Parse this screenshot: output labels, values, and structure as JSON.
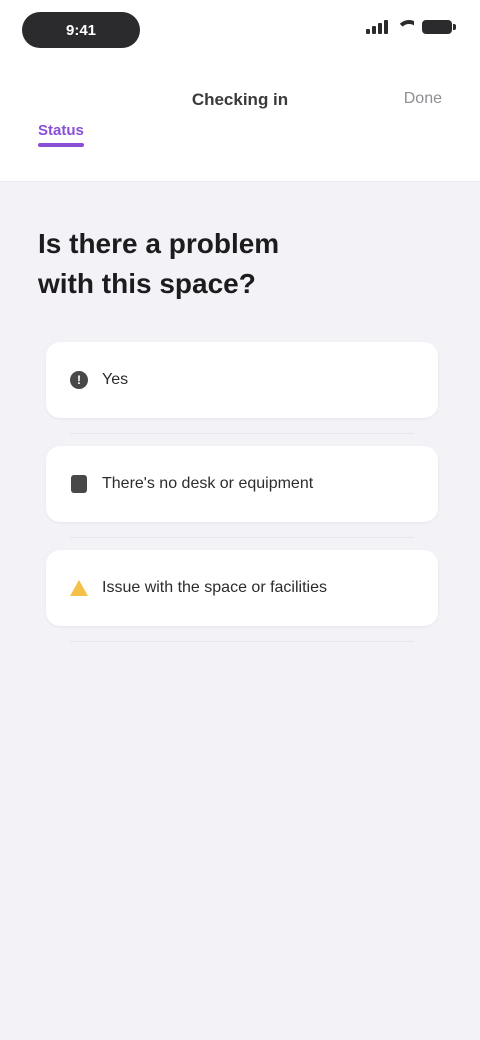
{
  "status_bar": {
    "time": "9:41",
    "signal_icon": "signal-icon",
    "wifi_icon": "wifi-icon",
    "battery_icon": "battery-icon"
  },
  "nav": {
    "title": "Checking in",
    "action_label": "Done",
    "selected_tab": "Status"
  },
  "heading": "Is there a problem with this space?",
  "options": [
    {
      "label": "Yes",
      "icon": "alert-icon"
    },
    {
      "label": "There's no desk or equipment",
      "icon": "grid-icon"
    },
    {
      "label": "Issue with the space or facilities",
      "icon": "warning-icon"
    }
  ],
  "colors": {
    "accent": "#8a4fd6",
    "background": "#f2f2f7",
    "card": "#ffffff",
    "warning": "#f5c04a"
  }
}
